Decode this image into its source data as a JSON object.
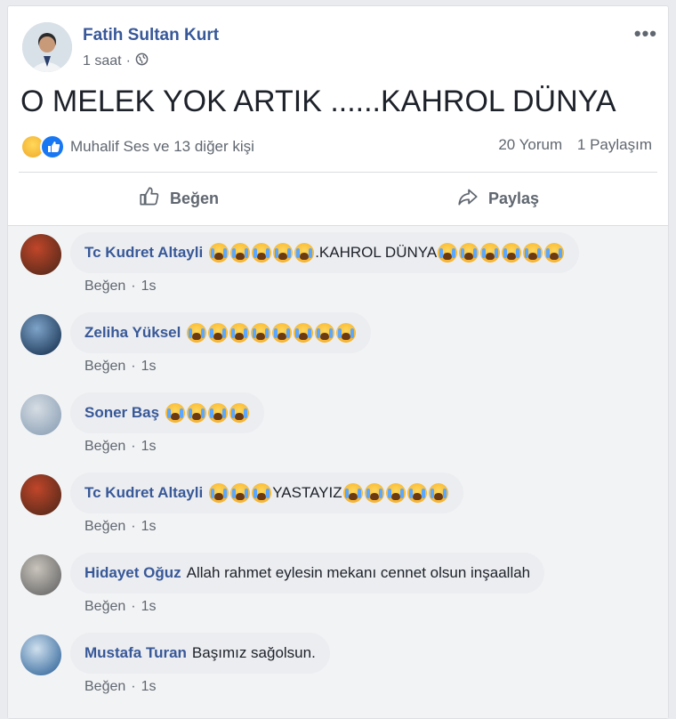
{
  "post": {
    "author": "Fatih Sultan Kurt",
    "time": "1 saat",
    "separator": "·",
    "text": "O MELEK YOK ARTIK ......KAHROL DÜNYA",
    "reactions_text": "Muhalif Ses ve 13 diğer kişi",
    "comments_count": "20 Yorum",
    "shares_count": "1 Paylaşım",
    "more_label": "•••"
  },
  "actions": {
    "like_label": "Beğen",
    "share_label": "Paylaş"
  },
  "comments": [
    {
      "author": "Tc Kudret Altayli",
      "segments": [
        {
          "emoji": 5
        },
        {
          "text": ".KAHROL DÜNYA"
        },
        {
          "emoji": 6
        }
      ],
      "like": "Beğen",
      "time": "1s"
    },
    {
      "author": "Zeliha Yüksel",
      "segments": [
        {
          "emoji": 8
        }
      ],
      "like": "Beğen",
      "time": "1s"
    },
    {
      "author": "Soner Baş",
      "segments": [
        {
          "emoji": 4
        }
      ],
      "like": "Beğen",
      "time": "1s"
    },
    {
      "author": "Tc Kudret Altayli",
      "segments": [
        {
          "emoji": 3
        },
        {
          "text": "YASTAYIZ"
        },
        {
          "emoji": 5
        }
      ],
      "like": "Beğen",
      "time": "1s"
    },
    {
      "author": "Hidayet Oğuz",
      "segments": [
        {
          "text": "Allah rahmet eylesin mekanı cennet olsun inşaallah"
        }
      ],
      "like": "Beğen",
      "time": "1s"
    },
    {
      "author": "Mustafa Turan",
      "segments": [
        {
          "text": "Başımız sağolsun."
        }
      ],
      "like": "Beğen",
      "time": "1s"
    }
  ],
  "icons": {
    "globe": "globe-icon",
    "like": "thumbs-up-icon",
    "share": "share-arrow-icon",
    "emoji": "crying-face-emoji"
  },
  "colors": {
    "name_link": "#385898",
    "secondary_text": "#606770",
    "bubble": "#ebedf0",
    "like_reaction": "#1877f2"
  }
}
